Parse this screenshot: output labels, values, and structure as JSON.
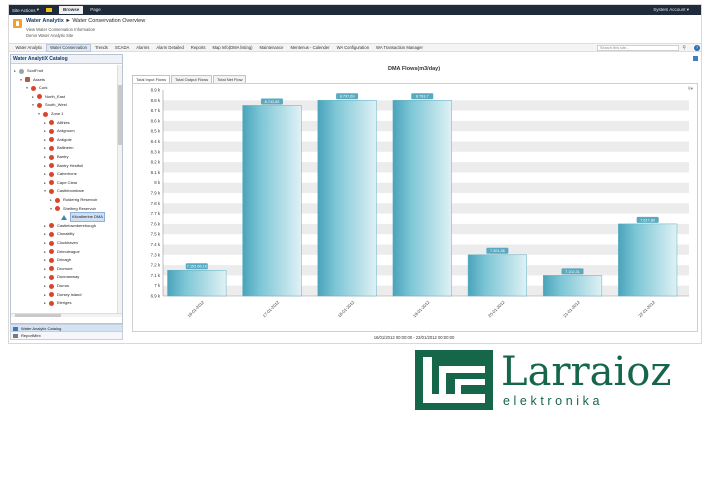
{
  "ribbon": {
    "site_actions": "Site Actions",
    "tabs": [
      "Browse",
      "Page"
    ],
    "account": "System Account"
  },
  "header": {
    "breadcrumb_root": "Water Analytix",
    "breadcrumb_sep": "►",
    "breadcrumb_page": "Water Conservation Overview",
    "subtitle": "View Water Conservation Information",
    "site_name": "Demo Water Analytix Site"
  },
  "nav": {
    "items": [
      "Water Analytix",
      "Water Conservation",
      "Trends",
      "SCADA",
      "Alarms",
      "Alarm Detailed",
      "Reports",
      "Map Info(DMA listing)",
      "Maintenance",
      "Mentenus - Calender",
      "WA Configuration",
      "WA Transaction Manager"
    ],
    "active_index": 1,
    "search_placeholder": "Search this site..."
  },
  "catalog": {
    "title": "Water AnalytiX Catalog",
    "tree": [
      {
        "label": "ScotFruit",
        "level": 0,
        "toggle": "▸",
        "icon": "grey"
      },
      {
        "label": "Assets",
        "level": 1,
        "toggle": "▾",
        "icon": "bldg"
      },
      {
        "label": "Cork",
        "level": 2,
        "toggle": "▾",
        "icon": "red"
      },
      {
        "label": "North_East",
        "level": 3,
        "toggle": "▸",
        "icon": "red"
      },
      {
        "label": "South_West",
        "level": 3,
        "toggle": "▾",
        "icon": "red"
      },
      {
        "label": "Zone 1",
        "level": 4,
        "toggle": "▾",
        "icon": "red"
      },
      {
        "label": "Allihies",
        "level": 5,
        "toggle": "▸",
        "icon": "red"
      },
      {
        "label": "Ardgroom",
        "level": 5,
        "toggle": "▸",
        "icon": "red"
      },
      {
        "label": "Ardigole",
        "level": 5,
        "toggle": "▸",
        "icon": "red"
      },
      {
        "label": "Ballineen",
        "level": 5,
        "toggle": "▸",
        "icon": "red"
      },
      {
        "label": "Bantry",
        "level": 5,
        "toggle": "▸",
        "icon": "red"
      },
      {
        "label": "Bantry Hestfull",
        "level": 5,
        "toggle": "▸",
        "icon": "red"
      },
      {
        "label": "Caherhone",
        "level": 5,
        "toggle": "▸",
        "icon": "red"
      },
      {
        "label": "Cape Clear",
        "level": 5,
        "toggle": "▸",
        "icon": "red"
      },
      {
        "label": "Castlebombare",
        "level": 5,
        "toggle": "▾",
        "icon": "red"
      },
      {
        "label": "Rolderrig Reservoir",
        "level": 6,
        "toggle": "▸",
        "icon": "red"
      },
      {
        "label": "Shelbeg Reservoir",
        "level": 6,
        "toggle": "▾",
        "icon": "red"
      },
      {
        "label": "Kilcatherine DMA",
        "level": 7,
        "toggle": "",
        "icon": "tri",
        "selected": true
      },
      {
        "label": "Castletownberehough",
        "level": 5,
        "toggle": "▸",
        "icon": "red"
      },
      {
        "label": "Clonakilty",
        "level": 5,
        "toggle": "▸",
        "icon": "red"
      },
      {
        "label": "Clockhaven",
        "level": 5,
        "toggle": "▸",
        "icon": "red"
      },
      {
        "label": "Drimoleague",
        "level": 5,
        "toggle": "▸",
        "icon": "red"
      },
      {
        "label": "Drinagh",
        "level": 5,
        "toggle": "▸",
        "icon": "red"
      },
      {
        "label": "Dromore",
        "level": 5,
        "toggle": "▸",
        "icon": "red"
      },
      {
        "label": "Dunmanway",
        "level": 5,
        "toggle": "▸",
        "icon": "red"
      },
      {
        "label": "Durrus",
        "level": 5,
        "toggle": "▸",
        "icon": "red"
      },
      {
        "label": "Dursey Island",
        "level": 5,
        "toggle": "▸",
        "icon": "red"
      },
      {
        "label": "Eleriges",
        "level": 5,
        "toggle": "▸",
        "icon": "red"
      }
    ],
    "bottom_tabs": [
      "Water Analytix Catalog",
      "ReportMint"
    ]
  },
  "chart_tabs": [
    "Total Input Flows",
    "Total Output Flows",
    "Total Net Flow"
  ],
  "chart_data": {
    "type": "bar",
    "title": "DMA Flows(m3/day)",
    "categories": [
      "16-01-2012",
      "17-01-2012",
      "18-01-2012",
      "19-01-2012",
      "20-01-2012",
      "21-01-2012",
      "22-01-2012"
    ],
    "values": [
      7.15,
      8.75,
      8.8,
      8.8,
      7.3,
      7.1,
      7.6
    ],
    "data_labels": [
      "7.152,66,10",
      "8.742,85",
      "8.797,69",
      "8.793,7",
      "7.301,36",
      "7.102,31",
      "7.617,80"
    ],
    "yticks": [
      "6.9 k",
      "7 k",
      "7.1 k",
      "7.2 k",
      "7.3 k",
      "7.4 k",
      "7.5 k",
      "7.6 k",
      "7.7 k",
      "7.8 k",
      "7.9 k",
      "8 k",
      "8.1 k",
      "8.2 k",
      "8.3 k",
      "8.4 k",
      "8.5 k",
      "8.6 k",
      "8.7 k",
      "8.8 k",
      "8.9 k"
    ],
    "ylim": [
      6.9,
      8.9
    ],
    "grid": true,
    "xlabel": "",
    "ylabel": "",
    "date_range": "16/01/2012 00:00:00 - 23/01/2012 00:00:00",
    "colors": {
      "bar": "#7cc6d6",
      "bar_dark": "#4aa3ba",
      "label_bg": "#59a9c0"
    }
  },
  "logo": {
    "name": "Larraioz",
    "tagline": "elektronika",
    "color": "#16664a"
  }
}
